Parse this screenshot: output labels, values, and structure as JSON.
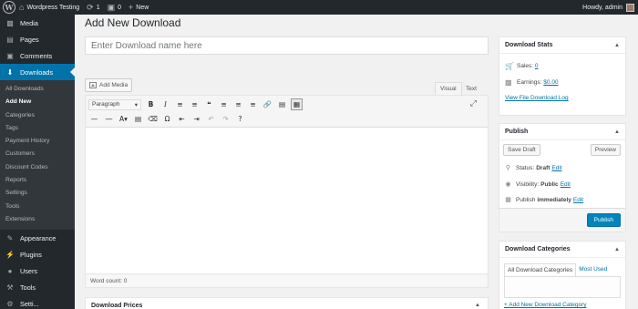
{
  "adminbar": {
    "site_name": "Wordpress Testing",
    "updates_count": "1",
    "comments_count": "0",
    "new_label": "New",
    "howdy": "Howdy, admin"
  },
  "sidebar": {
    "top_items": [
      {
        "label": "Media",
        "icon": "media-icon"
      },
      {
        "label": "Pages",
        "icon": "pages-icon"
      },
      {
        "label": "Comments",
        "icon": "comments-icon"
      }
    ],
    "current_item": {
      "label": "Downloads",
      "icon": "download-icon"
    },
    "submenu": [
      {
        "label": "All Downloads",
        "active": false
      },
      {
        "label": "Add New",
        "active": true
      },
      {
        "label": "Categories",
        "active": false
      },
      {
        "label": "Tags",
        "active": false
      },
      {
        "label": "Payment History",
        "active": false
      },
      {
        "label": "Customers",
        "active": false
      },
      {
        "label": "Discount Codes",
        "active": false
      },
      {
        "label": "Reports",
        "active": false
      },
      {
        "label": "Settings",
        "active": false
      },
      {
        "label": "Tools",
        "active": false
      },
      {
        "label": "Extensions",
        "active": false
      }
    ],
    "bottom_items": [
      {
        "label": "Appearance",
        "icon": "appearance-icon"
      },
      {
        "label": "Plugins",
        "icon": "plugins-icon"
      },
      {
        "label": "Users",
        "icon": "users-icon"
      },
      {
        "label": "Tools",
        "icon": "tools-icon"
      },
      {
        "label": "Setti...",
        "icon": "settings-icon"
      }
    ]
  },
  "page": {
    "title": "Add New Download",
    "title_placeholder": "Enter Download name here"
  },
  "editor": {
    "add_media_label": "Add Media",
    "tab_visual": "Visual",
    "tab_text": "Text",
    "format_value": "Paragraph",
    "word_count": "Word count: 0"
  },
  "prices_box": {
    "title": "Download Prices"
  },
  "stats": {
    "title": "Download Stats",
    "sales_label": "Sales:",
    "sales_value": "0",
    "earnings_label": "Earnings:",
    "earnings_value": "$0.00",
    "file_log_link": "View File Download Log"
  },
  "publish": {
    "title": "Publish",
    "save_draft": "Save Draft",
    "preview": "Preview",
    "status_label": "Status:",
    "status_value": "Draft",
    "visibility_label": "Visibility:",
    "visibility_value": "Public",
    "publish_label": "Publish",
    "publish_value": "immediately",
    "edit_label": "Edit",
    "publish_button": "Publish"
  },
  "categories": {
    "title": "Download Categories",
    "tab_all": "All Download Categories",
    "tab_most_used": "Most Used",
    "add_new_link": "+ Add New Download Category"
  },
  "colors": {
    "admin_bar": "#23282d",
    "menu_current": "#0073aa",
    "primary_button": "#0085ba",
    "link": "#0073aa"
  }
}
